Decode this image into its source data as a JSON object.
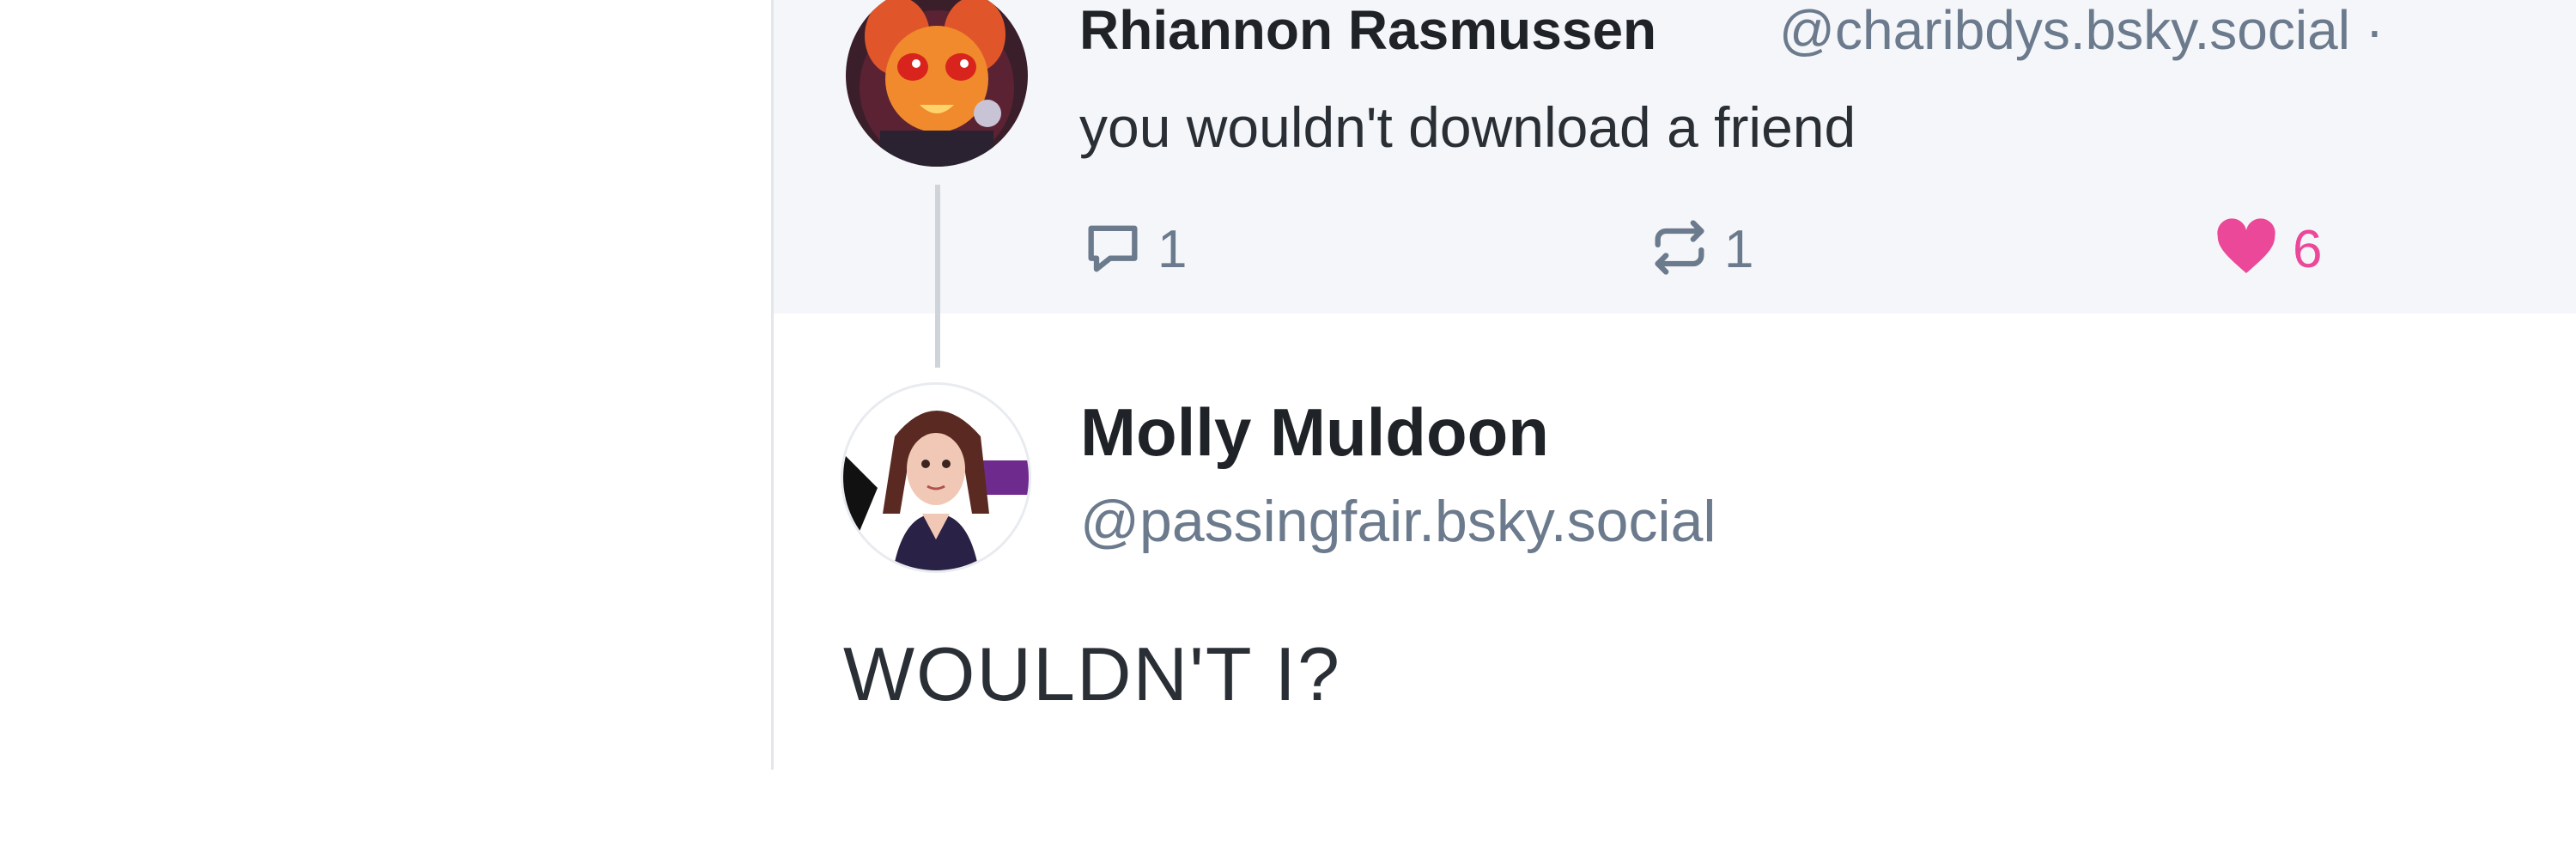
{
  "parent_post": {
    "author_name": "Rhiannon Rasmussen",
    "author_handle": "@charibdys.bsky.social ·",
    "text": "you wouldn't download a friend",
    "reply_count": "1",
    "repost_count": "1",
    "like_count": "6",
    "icons": {
      "reply": "reply-bubble-icon",
      "repost": "repost-icon",
      "like": "heart-icon"
    },
    "like_color": "#ec4899"
  },
  "reply_post": {
    "author_name": "Molly Muldoon",
    "author_handle": "@passingfair.bsky.social",
    "text": "WOULDN'T I?"
  }
}
